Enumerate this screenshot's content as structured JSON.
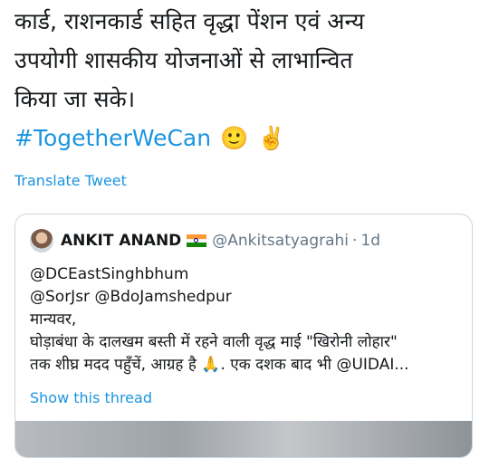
{
  "tweet": {
    "lines": [
      "कार्ड, राशनकार्ड सहित वृद्धा पेंशन एवं अन्य",
      "उपयोगी शासकीय योजनाओं से लाभान्वित",
      "किया जा सके।"
    ],
    "hashtag": "#TogetherWeCan",
    "emojis": [
      "🙂",
      "✌️"
    ],
    "translate_label": "Translate Tweet"
  },
  "quoted_tweet": {
    "author_name": "ANKIT ANAND",
    "author_flag": "india-flag",
    "handle": "@Ankitsatyagrahi",
    "separator": "·",
    "date": "1d",
    "body_lines": [
      "@DCEastSinghbhum",
      "@SorJsr @BdoJamshedpur",
      "मान्यवर,",
      "घोड़ाबंधा के दालखम बस्ती में रहने वाली वृद्ध माई \"खिरोनी लोहार\"",
      "तक शीघ्र मदद पहुँचें, आग्रह है 🙏. एक दशक बाद भी @UIDAI..."
    ],
    "show_thread_label": "Show this thread"
  },
  "colors": {
    "link": "#1b95e0",
    "text": "#14171a",
    "muted": "#657786",
    "border": "#ccd6dd"
  }
}
